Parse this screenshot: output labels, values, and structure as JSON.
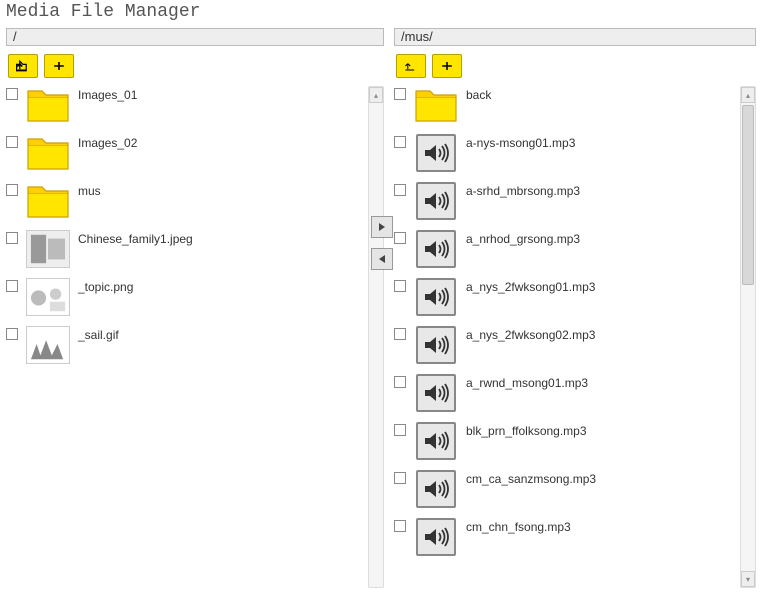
{
  "title": "Media File Manager",
  "left": {
    "path": "/",
    "items": [
      {
        "type": "folder",
        "label": "Images_01"
      },
      {
        "type": "folder",
        "label": "Images_02"
      },
      {
        "type": "folder",
        "label": "mus"
      },
      {
        "type": "image",
        "label": "Chinese_family1.jpeg"
      },
      {
        "type": "image",
        "label": "_topic.png"
      },
      {
        "type": "image",
        "label": "_sail.gif"
      }
    ]
  },
  "right": {
    "path": "/mus/",
    "items": [
      {
        "type": "folder",
        "label": "back"
      },
      {
        "type": "audio",
        "label": "a-nys-msong01.mp3"
      },
      {
        "type": "audio",
        "label": "a-srhd_mbrsong.mp3"
      },
      {
        "type": "audio",
        "label": "a_nrhod_grsong.mp3"
      },
      {
        "type": "audio",
        "label": "a_nys_2fwksong01.mp3"
      },
      {
        "type": "audio",
        "label": "a_nys_2fwksong02.mp3"
      },
      {
        "type": "audio",
        "label": "a_rwnd_msong01.mp3"
      },
      {
        "type": "audio",
        "label": "blk_prn_ffolksong.mp3"
      },
      {
        "type": "audio",
        "label": "cm_ca_sanzmsong.mp3"
      },
      {
        "type": "audio",
        "label": "cm_chn_fsong.mp3"
      }
    ]
  }
}
